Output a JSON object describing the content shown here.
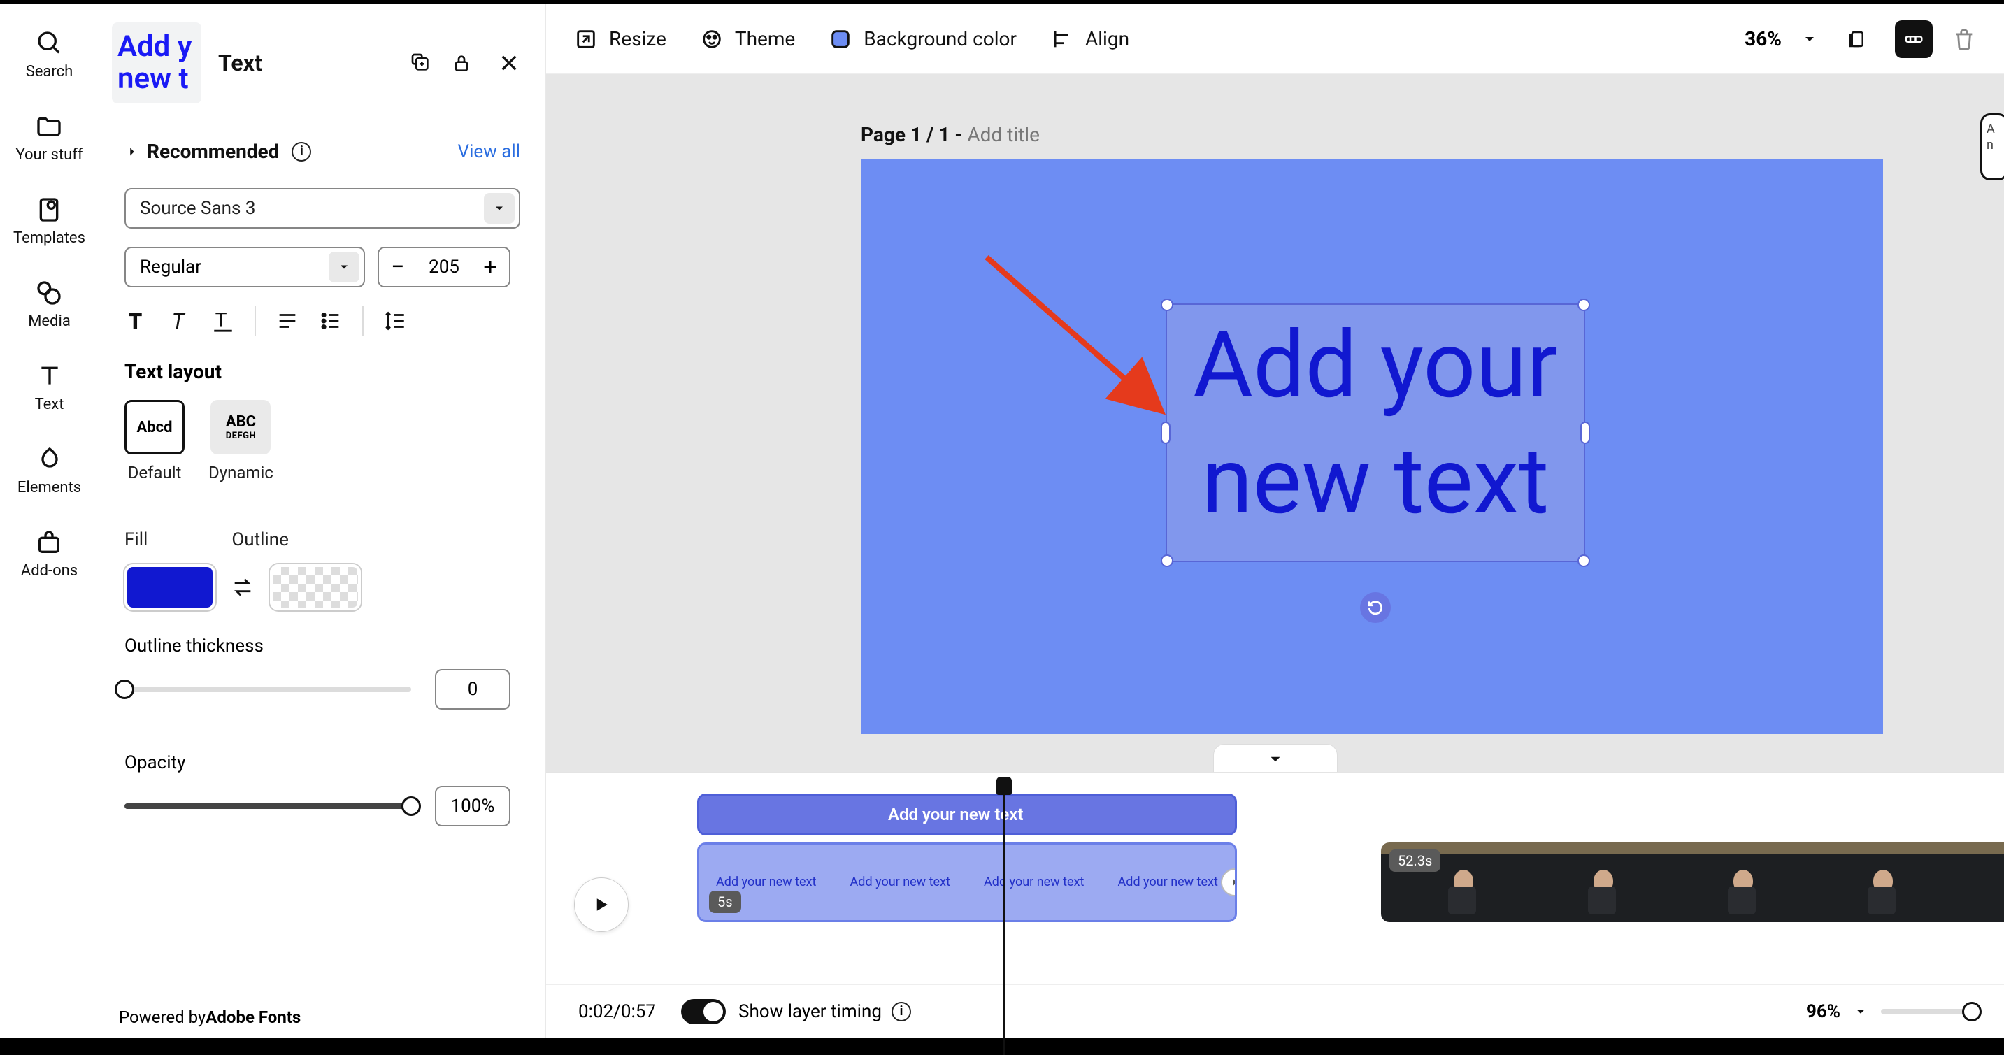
{
  "leftnav": [
    {
      "icon": "search",
      "label": "Search"
    },
    {
      "icon": "folder",
      "label": "Your stuff"
    },
    {
      "icon": "templates",
      "label": "Templates"
    },
    {
      "icon": "media",
      "label": "Media"
    },
    {
      "icon": "text",
      "label": "Text"
    },
    {
      "icon": "elements",
      "label": "Elements"
    },
    {
      "icon": "addons",
      "label": "Add-ons"
    }
  ],
  "panel": {
    "thumb_l1": "Add y",
    "thumb_l2": "new t",
    "title": "Text",
    "recommended": "Recommended",
    "view_all": "View all",
    "font": "Source Sans 3",
    "font_style": "Regular",
    "font_size": "205",
    "layout_heading": "Text layout",
    "layout": [
      {
        "big": "Abcd",
        "small": "",
        "label": "Default"
      },
      {
        "big": "ABC",
        "small": "DEFGH",
        "label": "Dynamic"
      }
    ],
    "fill": "Fill",
    "outline": "Outline",
    "fill_color": "#1118d0",
    "outline_thickness_label": "Outline thickness",
    "outline_thickness": "0",
    "opacity_label": "Opacity",
    "opacity": "100%",
    "footer": "Powered by ",
    "footer_b": "Adobe Fonts"
  },
  "toolbar": {
    "resize": "Resize",
    "theme": "Theme",
    "bg": "Background color",
    "align": "Align",
    "zoom": "36%"
  },
  "canvas": {
    "page_label": "Page 1 / 1 - ",
    "page_title": "Add title",
    "text_l1": "Add your",
    "text_l2": "new text",
    "bg_color": "#6d8df3"
  },
  "timeline": {
    "text_layer_label": "Add your new text",
    "scene_text": "Add your new text",
    "scene_badge": "5s",
    "video_time": "52.3s",
    "timecode": "0:02/0:57",
    "show_layer": "Show layer timing",
    "zoom": "96%"
  }
}
